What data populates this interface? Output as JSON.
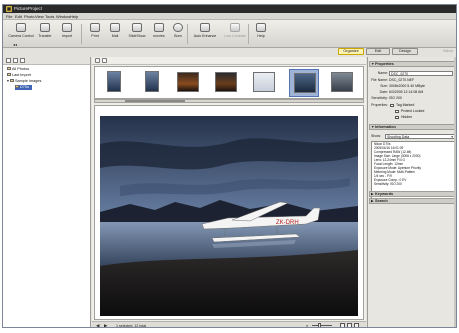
{
  "window": {
    "title": "PictureProject"
  },
  "menu": [
    "File",
    "Edit",
    "Photo",
    "View",
    "Tools",
    "Window",
    "Help"
  ],
  "toolbar": {
    "buttons": [
      {
        "label": "Camera Control",
        "icon": "camera-icon",
        "enabled": true
      },
      {
        "label": "Transfer",
        "icon": "transfer-icon",
        "enabled": true
      },
      {
        "label": "Import",
        "icon": "import-icon",
        "enabled": true
      },
      {
        "label": "Print",
        "icon": "print-icon",
        "enabled": true
      },
      {
        "label": "Mail",
        "icon": "mail-icon",
        "enabled": true
      },
      {
        "label": "SlideShow",
        "icon": "slideshow-icon",
        "enabled": true
      },
      {
        "label": "movies",
        "icon": "movie-icon",
        "enabled": true
      },
      {
        "label": "Burn",
        "icon": "disc-icon",
        "enabled": true
      },
      {
        "label": "Auto Enhance",
        "icon": "enhance-icon",
        "enabled": true
      },
      {
        "label": "Low Contrast",
        "icon": "contrast-icon",
        "enabled": false
      },
      {
        "label": "Help",
        "icon": "help-icon",
        "enabled": true
      }
    ]
  },
  "tabs": [
    "Organize",
    "Edit",
    "Design"
  ],
  "brand": "Nikon",
  "tree": {
    "items": [
      {
        "label": "All Photos"
      },
      {
        "label": "Last Import"
      },
      {
        "label": "Sample Images"
      },
      {
        "label": "D70s"
      }
    ]
  },
  "status": {
    "text": "1 selected, 12 total",
    "prev": "◀",
    "next": "▶"
  },
  "properties": {
    "header": "Properties",
    "name_label": "Name:",
    "name_value": "DSC_0270",
    "file_name_label": "File Name:",
    "file_name_value": "DSC_0270.NEF",
    "size_label": "Size:",
    "size_value": "3008x2000  5.40 MByte",
    "date_label": "Date:",
    "date_value": "6/3/2005 12:14:08 AM",
    "sensitivity_label": "Sensitivity:",
    "sensitivity_value": "ISO 200",
    "properties_label": "Properties:",
    "tag_marked": "Tag Marked",
    "protect_locked": "Protect Locked",
    "hidden": "Hidden"
  },
  "information": {
    "header": "Information",
    "show_label": "Show:",
    "show_value": "Shooting Data",
    "lines": [
      "Nikon D70s",
      "2005/04/16 16:01:09",
      "Compressed RAW (12-bit)",
      "Image Size: Large (3008 x 2000)",
      "Lens: 12-24mm F/4 G",
      "Focal Length: 12mm",
      "Exposure Mode: Aperture Priority",
      "Metering Mode: Multi-Pattern",
      "1/4 sec - F/9",
      "Exposure Comp.: 0 EV",
      "Sensitivity: ISO 200"
    ]
  },
  "keywords": {
    "header": "Keywords"
  },
  "search": {
    "header": "Search"
  },
  "photo": {
    "registration": "ZK-DRH"
  }
}
